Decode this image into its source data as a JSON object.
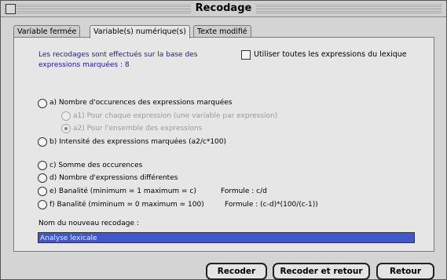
{
  "window": {
    "title": "Recodage"
  },
  "tabs": [
    {
      "label": "Variable fermée"
    },
    {
      "label": "Variable(s) numérique(s)"
    },
    {
      "label": "Texte modifié"
    }
  ],
  "info": {
    "line1": "Les recodages sont effectués sur la base des",
    "line2": "expressions marquées : 8"
  },
  "checkbox_all": {
    "label": "Utiliser toutes les expressions du lexique",
    "checked": false
  },
  "options": {
    "a": "a) Nombre d'occurences des expressions marquées",
    "a1": "a1) Pour chaque expression (une variable par expression)",
    "a2": "a2) Pour l'ensemble des expressions",
    "b": "b) Intensité des expressions marquées (a2/c*100)",
    "c": "c) Somme des occurences",
    "d": "d) Nombre d'expressions différentes",
    "e": "e) Banalité (minimum = 1 maximum = c)",
    "e_formula": "Formule : c/d",
    "f": "f) Banalité (miminum = 0 maximum = 100)",
    "f_formula": "Formule : (c-d)*(100/(c-1))"
  },
  "name_field": {
    "label": "Nom du nouveau recodage :",
    "value": "Analyse lexicale"
  },
  "buttons": {
    "recoder": "Recoder",
    "recoder_retour": "Recoder et retour",
    "retour": "Retour"
  }
}
